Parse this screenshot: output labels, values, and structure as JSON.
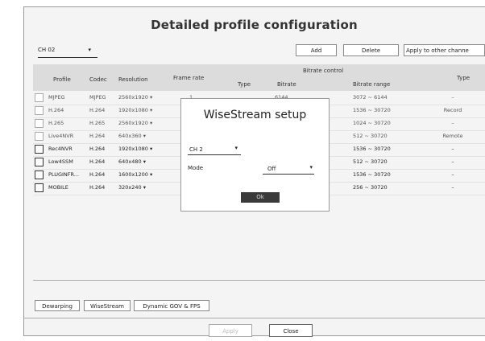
{
  "title": "Detailed profile configuration",
  "channel_select": {
    "value": "CH 02",
    "arrow": "▾"
  },
  "toolbar": {
    "add": "Add",
    "delete": "Delete",
    "apply_other": "Apply to other channe"
  },
  "headers": {
    "profile": "Profile",
    "codec": "Codec",
    "resolution": "Resolution",
    "frame_rate": "Frame rate",
    "bitrate_control": "Bitrate control",
    "bc_type": "Type",
    "bitrate": "Bitrate",
    "bitrate_range": "Bitrate range",
    "type": "Type"
  },
  "rows": [
    {
      "profile": "MJPEG",
      "codec": "MJPEG",
      "resolution": "2560x1920 ▾",
      "range": "3072 ~ 6144",
      "type": "–",
      "style": "light"
    },
    {
      "profile": "H.264",
      "codec": "H.264",
      "resolution": "1920x1080 ▾",
      "range": "1536 ~ 30720",
      "type": "Record",
      "style": "light"
    },
    {
      "profile": "H.265",
      "codec": "H.265",
      "resolution": "2560x1920 ▾",
      "range": "1024 ~ 30720",
      "type": "–",
      "style": "light"
    },
    {
      "profile": "Live4NVR",
      "codec": "H.264",
      "resolution": "640x360 ▾",
      "range": "512 ~ 30720",
      "type": "Remote",
      "style": "light"
    },
    {
      "profile": "Rec4NVR",
      "codec": "H.264",
      "resolution": "1920x1080 ▾",
      "range": "1536 ~ 30720",
      "type": "–",
      "style": "bold"
    },
    {
      "profile": "Low4SSM",
      "codec": "H.264",
      "resolution": "640x480 ▾",
      "range": "512 ~ 30720",
      "type": "–",
      "style": "bold"
    },
    {
      "profile": "PLUGINFR...",
      "codec": "H.264",
      "resolution": "1600x1200 ▾",
      "range": "1536 ~ 30720",
      "type": "–",
      "style": "bold"
    },
    {
      "profile": "MOBILE",
      "codec": "H.264",
      "resolution": "320x240 ▾",
      "range": "256 ~ 30720",
      "type": "–",
      "style": "bold"
    }
  ],
  "partial": {
    "frame": "1",
    "bitrate": "6144"
  },
  "bottom_buttons": {
    "dewarping": "Dewarping",
    "wisestream": "WiseStream",
    "dynamic": "Dynamic GOV & FPS"
  },
  "footer": {
    "apply": "Apply",
    "close": "Close"
  },
  "dialog": {
    "title": "WiseStream setup",
    "channel": "CH 2",
    "mode_label": "Mode",
    "mode_value": "Off",
    "arrow": "▾",
    "ok": "Ok"
  }
}
